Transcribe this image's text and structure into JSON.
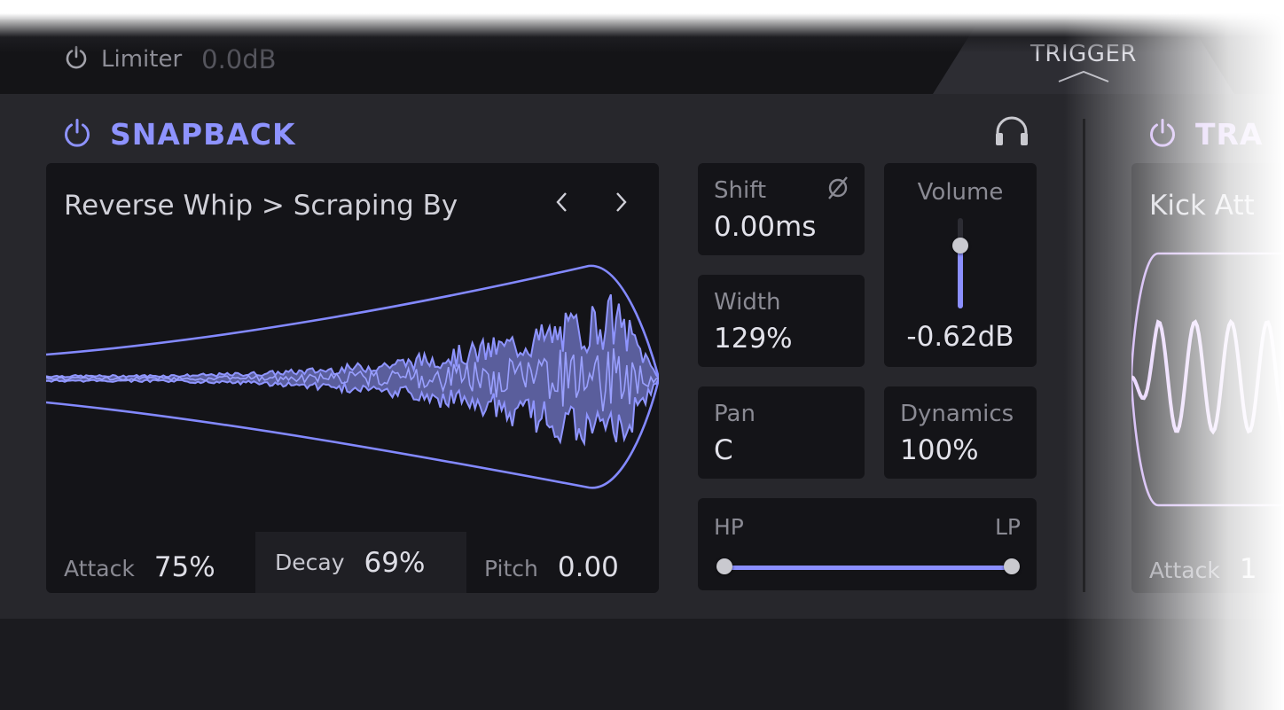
{
  "topbar": {
    "limiter_label": "Limiter",
    "limiter_value": "0.0dB",
    "trigger_tab": "TRIGGER"
  },
  "snapback": {
    "title": "SNAPBACK",
    "accent": "#8e93ff",
    "preset": "Reverse Whip > Scraping By",
    "attack_label": "Attack",
    "attack_value": "75%",
    "decay_label": "Decay",
    "decay_value": "69%",
    "pitch_label": "Pitch",
    "pitch_value": "0.00"
  },
  "controls": {
    "shift_label": "Shift",
    "shift_value": "0.00ms",
    "width_label": "Width",
    "width_value": "129%",
    "pan_label": "Pan",
    "pan_value": "C",
    "volume_label": "Volume",
    "volume_value": "-0.62dB",
    "volume_level": 0.7,
    "dynamics_label": "Dynamics",
    "dynamics_value": "100%",
    "hp_label": "HP",
    "lp_label": "LP",
    "hp_position": 0.0,
    "lp_position": 1.0
  },
  "second_layer": {
    "title": "TRA",
    "accent": "#c8a7f2",
    "preset": "Kick Att",
    "attack_label": "Attack",
    "attack_value": "1"
  },
  "icons": [
    "power-icon",
    "chevron-up-icon",
    "headphones-icon",
    "chevron-left-icon",
    "chevron-right-icon",
    "phase-invert-icon"
  ]
}
